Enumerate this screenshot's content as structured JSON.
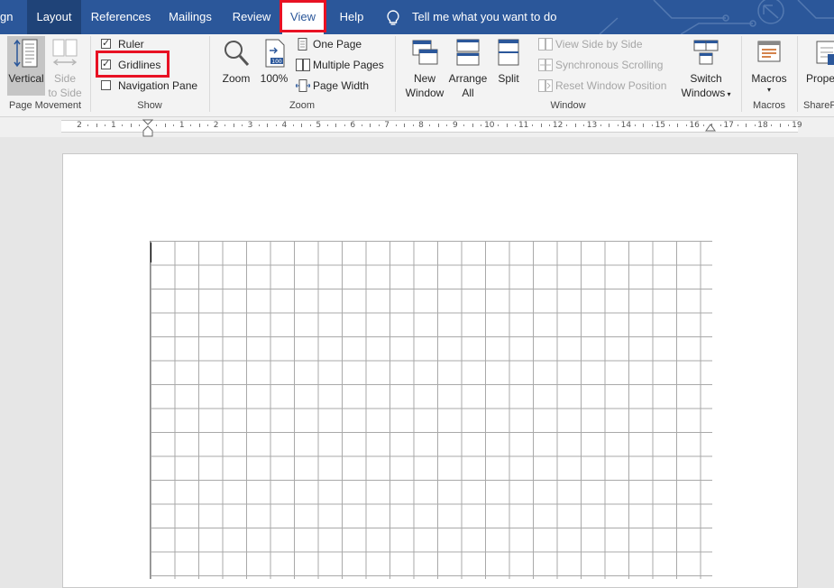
{
  "tabs": [
    {
      "label": "gn"
    },
    {
      "label": "Layout"
    },
    {
      "label": "References"
    },
    {
      "label": "Mailings"
    },
    {
      "label": "Review"
    },
    {
      "label": "View"
    },
    {
      "label": "Help"
    }
  ],
  "tell_me": "Tell me what you want to do",
  "ribbon": {
    "page_movement": {
      "label": "Page Movement",
      "vertical": "Vertical",
      "side_to_side": [
        "Side",
        "to Side"
      ]
    },
    "show": {
      "label": "Show",
      "ruler": {
        "label": "Ruler",
        "checked": true
      },
      "gridlines": {
        "label": "Gridlines",
        "checked": true
      },
      "navigation_pane": {
        "label": "Navigation Pane",
        "checked": false
      }
    },
    "zoom": {
      "label": "Zoom",
      "zoom_btn": "Zoom",
      "hundred": "100%",
      "one_page": "One Page",
      "multiple_pages": "Multiple Pages",
      "page_width": "Page Width"
    },
    "window": {
      "label": "Window",
      "new_window": [
        "New",
        "Window"
      ],
      "arrange_all": [
        "Arrange",
        "All"
      ],
      "split": "Split",
      "view_side_by_side": "View Side by Side",
      "synchronous_scrolling": "Synchronous Scrolling",
      "reset_window_position": "Reset Window Position",
      "switch_windows": [
        "Switch",
        "Windows"
      ]
    },
    "macros": {
      "label": "Macros",
      "macros_btn": "Macros"
    },
    "sharepoint": {
      "label": "ShareP",
      "properties": "Prope"
    }
  },
  "ruler": {
    "marks": [
      "2",
      "1",
      "",
      "1",
      "2",
      "3",
      "4",
      "5",
      "6",
      "7",
      "8",
      "9",
      "10",
      "11",
      "12",
      "13",
      "14",
      "15",
      "16",
      "17",
      "18",
      "19"
    ]
  },
  "colors": {
    "tab_bar": "#2b579a",
    "highlight_frame": "#e81123"
  }
}
